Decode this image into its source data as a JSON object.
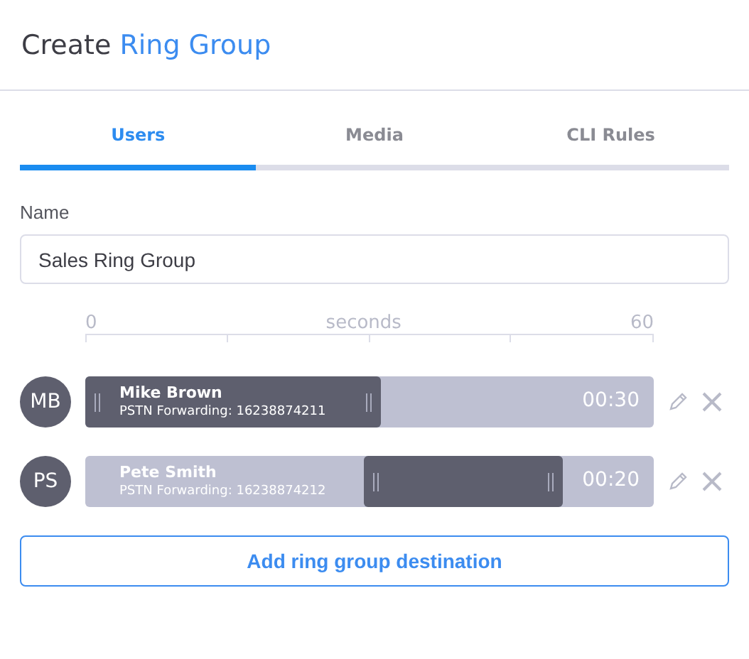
{
  "title": {
    "prefix": "Create",
    "highlight": "Ring Group"
  },
  "tabs": [
    {
      "label": "Users",
      "selected": true
    },
    {
      "label": "Media",
      "selected": false
    },
    {
      "label": "CLI Rules",
      "selected": false
    }
  ],
  "name_field": {
    "label": "Name",
    "value": "Sales Ring Group"
  },
  "scale": {
    "min": "0",
    "unit": "seconds",
    "max": "60"
  },
  "users": [
    {
      "initials": "MB",
      "name": "Mike Brown",
      "detail": "PSTN Forwarding: 16238874211",
      "time": "00:30",
      "handles": [
        {
          "level": 0
        },
        {
          "level": 0.52
        }
      ]
    },
    {
      "initials": "PS",
      "name": "Pete Smith",
      "detail": "PSTN Forwarding: 16238874212",
      "time": "00:20",
      "handles": [
        {
          "level": 0.49
        },
        {
          "level": 0.84
        }
      ]
    }
  ],
  "add_button": "Add ring group destination"
}
